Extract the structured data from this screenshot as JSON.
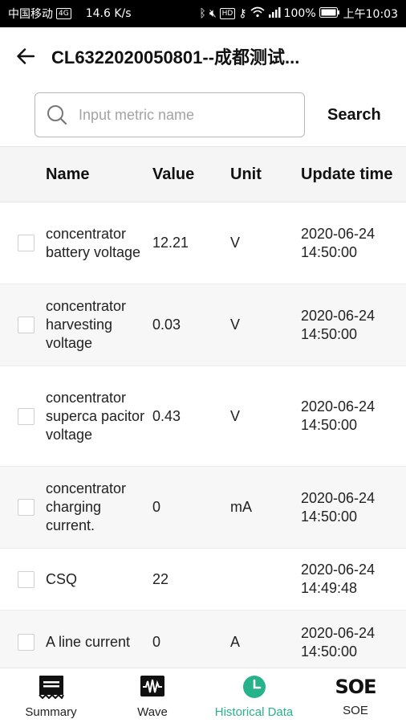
{
  "status_bar": {
    "carrier": "中国移动",
    "speed": "14.6 K/s",
    "hd_badge": "HD",
    "signal": "4G",
    "battery": "100%",
    "time": "上午10:03"
  },
  "app_bar": {
    "title": "CL6322020050801--成都测试..."
  },
  "search": {
    "placeholder": "Input metric name",
    "value": "",
    "button_label": "Search"
  },
  "table": {
    "headers": {
      "name": "Name",
      "value": "Value",
      "unit": "Unit",
      "time": "Update time"
    },
    "rows": [
      {
        "name": "concentrator battery voltage",
        "value": "12.21",
        "unit": "V",
        "time": "2020-06-24 14:50:00"
      },
      {
        "name": "concentrator harvesting voltage",
        "value": "0.03",
        "unit": "V",
        "time": "2020-06-24 14:50:00"
      },
      {
        "name": "concentrator superca pacitor voltage",
        "value": "0.43",
        "unit": "V",
        "time": "2020-06-24 14:50:00"
      },
      {
        "name": "concentrator charging current.",
        "value": "0",
        "unit": "mA",
        "time": "2020-06-24 14:50:00"
      },
      {
        "name": "CSQ",
        "value": "22",
        "unit": "",
        "time": "2020-06-24 14:49:48"
      },
      {
        "name": "A line current",
        "value": "0",
        "unit": "A",
        "time": "2020-06-24 14:50:00"
      }
    ]
  },
  "nav": {
    "items": [
      {
        "label": "Summary",
        "icon": "summary-icon",
        "active": false
      },
      {
        "label": "Wave",
        "icon": "wave-icon",
        "active": false
      },
      {
        "label": "Historical Data",
        "icon": "clock-icon",
        "active": true
      },
      {
        "label": "SOE",
        "icon": "soe-icon",
        "active": false
      }
    ],
    "soe_icon_text": "SOE"
  },
  "colors": {
    "accent": "#26b28a",
    "header_bg": "#f5f5f5",
    "alt_row_bg": "#f7f7f7"
  }
}
